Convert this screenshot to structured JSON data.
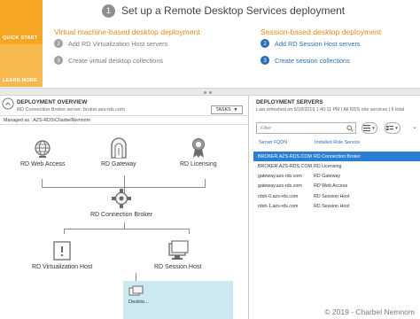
{
  "quick_start": {
    "quick_start_label": "QUICK START",
    "learn_more_label": "LEARN MORE"
  },
  "main_step": {
    "number": "1",
    "title": "Set up a Remote Desktop Services deployment"
  },
  "vm_column": {
    "heading": "Virtual machine-based desktop deployment",
    "steps": [
      {
        "number": "2",
        "label": "Add RD Virtualization Host servers"
      },
      {
        "number": "3",
        "label": "Create virtual desktop collections"
      }
    ]
  },
  "session_column": {
    "heading": "Session-based desktop deployment",
    "steps": [
      {
        "number": "2",
        "label": "Add RD Session Host servers"
      },
      {
        "number": "3",
        "label": "Create session collections"
      }
    ]
  },
  "overview": {
    "title": "DEPLOYMENT OVERVIEW",
    "subtitle": "RD Connection Broker server: broker.azs-rds.com",
    "tasks_label": "TASKS",
    "managed_as": "Managed as : AZS-RDS\\CharbelNemnom",
    "nodes": {
      "web_access": "RD Web Access",
      "gateway": "RD Gateway",
      "licensing": "RD Licensing",
      "broker": "RD Connection Broker",
      "virtualization": "RD Virtualization Host",
      "session_host": "RD Session Host"
    },
    "desktop_label": "Deskto..."
  },
  "servers": {
    "title": "DEPLOYMENT SERVERS",
    "subtitle": "Last refreshed on 5/18/2019 1:40:11 PM | All RDS role services | 6 total",
    "filter_placeholder": "Filter",
    "expand_glyph": "⌄",
    "columns": [
      "Server FQDN",
      "Installed Role Service"
    ],
    "rows": [
      {
        "fqdn": "BROKER.AZS-RDS.COM",
        "role": "RD Connection Broker",
        "selected": true
      },
      {
        "fqdn": "BROKER.AZS-RDS.COM",
        "role": "RD Licensing",
        "selected": false
      },
      {
        "fqdn": "gateway.azs-rds.com",
        "role": "RD Gateway",
        "selected": false
      },
      {
        "fqdn": "gateway.azs-rds.com",
        "role": "RD Web Access",
        "selected": false
      },
      {
        "fqdn": "rdsh-0.azs-rds.com",
        "role": "RD Session Host",
        "selected": false
      },
      {
        "fqdn": "rdsh-1.azs-rds.com",
        "role": "RD Session Host",
        "selected": false
      }
    ]
  },
  "credit": "© 2019 - Charbel Nemnom",
  "colors": {
    "accent_orange": "#e8891a",
    "link_blue": "#2a6db5",
    "selection": "#2a7ed3",
    "quick_start": "#f5a623"
  }
}
